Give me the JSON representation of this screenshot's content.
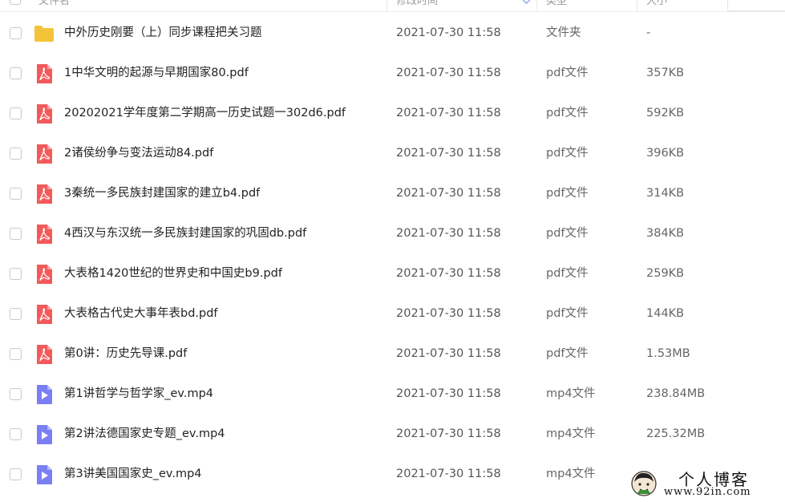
{
  "header": {
    "col_name": "文件名",
    "col_time": "修改时间",
    "col_type": "类型",
    "col_size": "大小"
  },
  "files": [
    {
      "kind": "folder",
      "name": "中外历史刚要（上）同步课程把关习题",
      "time": "2021-07-30 11:58",
      "type": "文件夹",
      "size": "-"
    },
    {
      "kind": "pdf",
      "name": "1中华文明的起源与早期国家80.pdf",
      "time": "2021-07-30 11:58",
      "type": "pdf文件",
      "size": "357KB"
    },
    {
      "kind": "pdf",
      "name": "20202021学年度第二学期高一历史试题一302d6.pdf",
      "time": "2021-07-30 11:58",
      "type": "pdf文件",
      "size": "592KB"
    },
    {
      "kind": "pdf",
      "name": "2诸侯纷争与变法运动84.pdf",
      "time": "2021-07-30 11:58",
      "type": "pdf文件",
      "size": "396KB"
    },
    {
      "kind": "pdf",
      "name": "3秦统一多民族封建国家的建立b4.pdf",
      "time": "2021-07-30 11:58",
      "type": "pdf文件",
      "size": "314KB"
    },
    {
      "kind": "pdf",
      "name": "4西汉与东汉统一多民族封建国家的巩固db.pdf",
      "time": "2021-07-30 11:58",
      "type": "pdf文件",
      "size": "384KB"
    },
    {
      "kind": "pdf",
      "name": "大表格1420世纪的世界史和中国史b9.pdf",
      "time": "2021-07-30 11:58",
      "type": "pdf文件",
      "size": "259KB"
    },
    {
      "kind": "pdf",
      "name": "大表格古代史大事年表bd.pdf",
      "time": "2021-07-30 11:58",
      "type": "pdf文件",
      "size": "144KB"
    },
    {
      "kind": "pdf",
      "name": "第0讲：历史先导课.pdf",
      "time": "2021-07-30 11:58",
      "type": "pdf文件",
      "size": "1.53MB"
    },
    {
      "kind": "video",
      "name": "第1讲哲学与哲学家_ev.mp4",
      "time": "2021-07-30 11:58",
      "type": "mp4文件",
      "size": "238.84MB"
    },
    {
      "kind": "video",
      "name": "第2讲法德国家史专题_ev.mp4",
      "time": "2021-07-30 11:58",
      "type": "mp4文件",
      "size": "225.32MB"
    },
    {
      "kind": "video",
      "name": "第3讲美国国家史_ev.mp4",
      "time": "2021-07-30 11:58",
      "type": "mp4文件",
      "size": ""
    }
  ],
  "icons": {
    "folder": "folder-icon",
    "pdf": "pdf-file-icon",
    "video": "video-file-icon"
  },
  "colors": {
    "folder": "#f5c33b",
    "pdf": "#f25a5a",
    "video": "#7b7ff5",
    "accent": "#6a8ce8"
  },
  "watermark": {
    "title": "个人博客",
    "url": "www.92in.com"
  }
}
